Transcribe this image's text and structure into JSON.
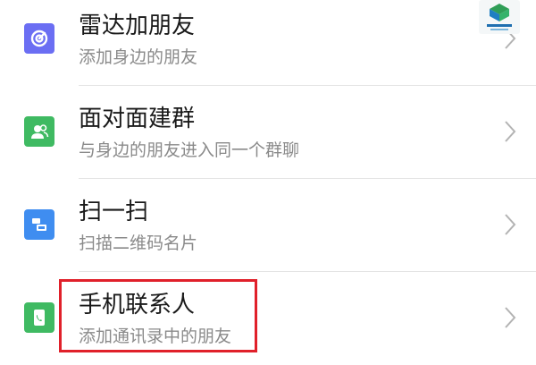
{
  "contacts_add_options": {
    "items": [
      {
        "title": "雷达加朋友",
        "subtitle": "添加身边的朋友",
        "icon": "radar-icon",
        "icon_color": "#6b6ef3"
      },
      {
        "title": "面对面建群",
        "subtitle": "与身边的朋友进入同一个群聊",
        "icon": "face-to-face-group-icon",
        "icon_color": "#3fba62"
      },
      {
        "title": "扫一扫",
        "subtitle": "扫描二维码名片",
        "icon": "scan-icon",
        "icon_color": "#3f8df0"
      },
      {
        "title": "手机联系人",
        "subtitle": "添加通讯录中的朋友",
        "icon": "phone-contacts-icon",
        "icon_color": "#3fba62"
      }
    ]
  },
  "annotation": {
    "highlight_color": "#e0202a"
  },
  "watermark": {
    "logo": "site-logo-icon"
  }
}
